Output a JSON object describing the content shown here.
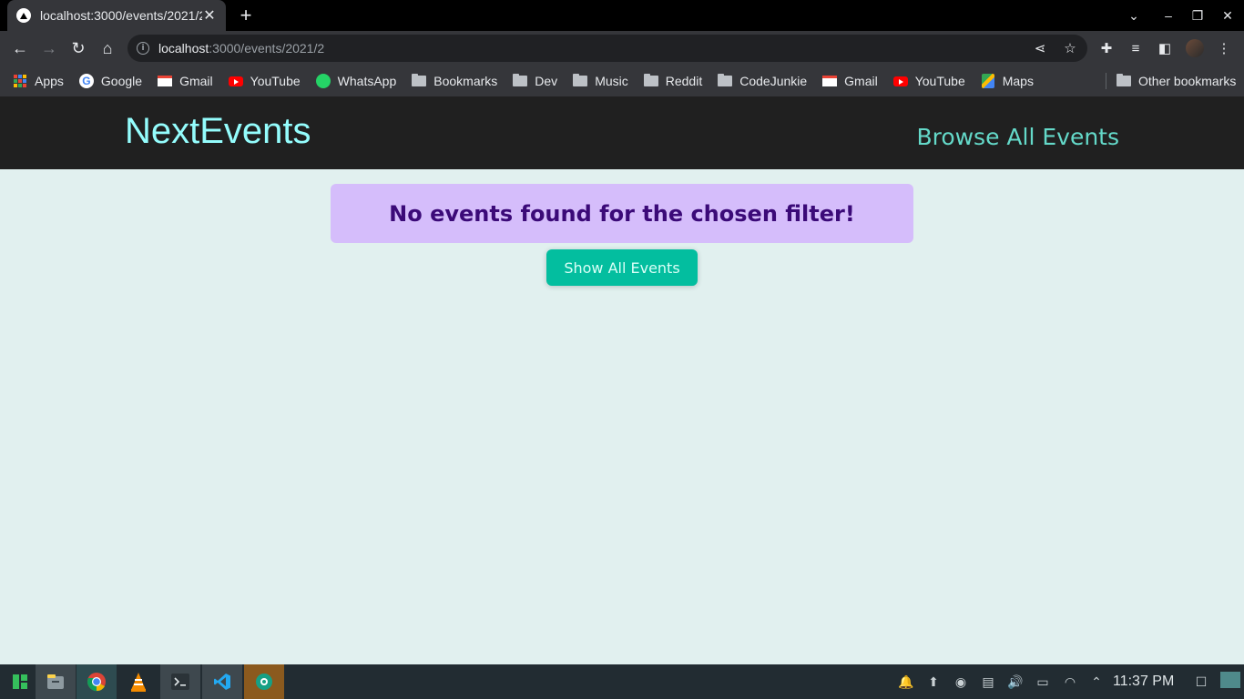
{
  "browser": {
    "tab_title": "localhost:3000/events/2021/2",
    "url_host": "localhost",
    "url_path": ":3000/events/2021/2",
    "bookmarks": [
      {
        "label": "Apps",
        "icon": "apps-grid-icon"
      },
      {
        "label": "Google",
        "icon": "google-icon"
      },
      {
        "label": "Gmail",
        "icon": "gmail-icon"
      },
      {
        "label": "YouTube",
        "icon": "youtube-icon"
      },
      {
        "label": "WhatsApp",
        "icon": "whatsapp-icon"
      },
      {
        "label": "Bookmarks",
        "icon": "folder-icon"
      },
      {
        "label": "Dev",
        "icon": "folder-icon"
      },
      {
        "label": "Music",
        "icon": "folder-icon"
      },
      {
        "label": "Reddit",
        "icon": "folder-icon"
      },
      {
        "label": "CodeJunkie",
        "icon": "folder-icon"
      },
      {
        "label": "Gmail",
        "icon": "gmail-icon"
      },
      {
        "label": "YouTube",
        "icon": "youtube-icon"
      },
      {
        "label": "Maps",
        "icon": "maps-icon"
      }
    ],
    "other_bookmarks": "Other bookmarks"
  },
  "site": {
    "logo": "NextEvents",
    "nav_link": "Browse All Events",
    "alert_message": "No events found for the chosen filter!",
    "show_all_button": "Show All Events",
    "colors": {
      "header_bg": "#202020",
      "logo": "#94fdfd",
      "nav_link": "#64d9c9",
      "page_bg": "#e1f0ef",
      "alert_bg": "#d5bdfb",
      "alert_text": "#3b0a78",
      "button_bg": "#03be9f"
    }
  },
  "taskbar": {
    "apps": [
      "manjaro-icon",
      "file-manager-icon",
      "chrome-icon",
      "vlc-icon",
      "terminal-icon",
      "vscode-icon",
      "aperture-icon"
    ],
    "tray": [
      "notification-icon",
      "update-icon",
      "steam-icon",
      "clipboard-icon",
      "volume-icon",
      "battery-icon",
      "wifi-icon",
      "tray-expand-icon"
    ],
    "clock": "11:37 PM"
  }
}
